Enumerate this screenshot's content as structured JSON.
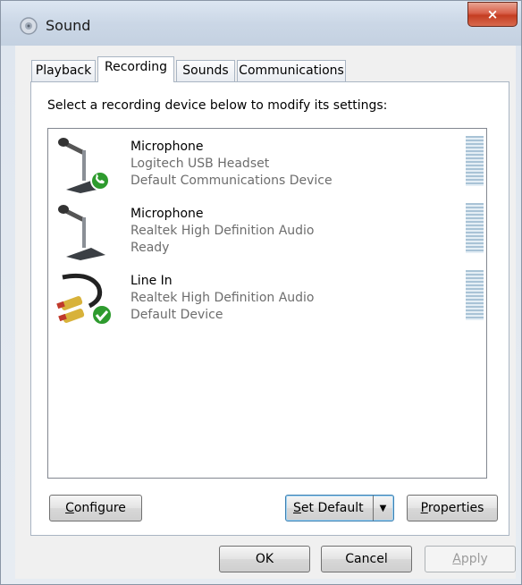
{
  "window": {
    "title": "Sound",
    "icon": "speaker-icon",
    "close_label": "×"
  },
  "tabs": [
    {
      "label": "Playback",
      "active": false
    },
    {
      "label": "Recording",
      "active": true
    },
    {
      "label": "Sounds",
      "active": false
    },
    {
      "label": "Communications",
      "active": false
    }
  ],
  "panel": {
    "instruction": "Select a recording device below to modify its settings:"
  },
  "devices": [
    {
      "name": "Microphone",
      "driver": "Logitech USB Headset",
      "status": "Default Communications Device",
      "icon": "microphone-icon",
      "badge": "phone-check-icon"
    },
    {
      "name": "Microphone",
      "driver": "Realtek High Definition Audio",
      "status": "Ready",
      "icon": "microphone-icon",
      "badge": ""
    },
    {
      "name": "Line In",
      "driver": "Realtek High Definition Audio",
      "status": "Default Device",
      "icon": "line-in-cable-icon",
      "badge": "checkmark-icon"
    }
  ],
  "buttons": {
    "configure": "Configure",
    "set_default": "Set Default",
    "properties": "Properties",
    "ok": "OK",
    "cancel": "Cancel",
    "apply": "Apply"
  },
  "colors": {
    "check_green": "#2e9b2e",
    "meter_bar": "#a9c3d6"
  }
}
